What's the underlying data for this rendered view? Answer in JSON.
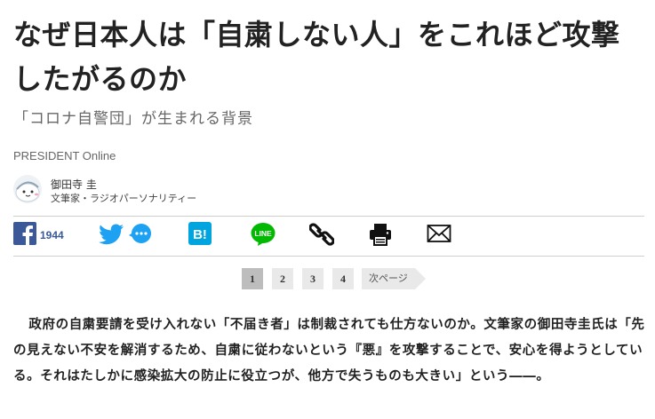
{
  "article": {
    "title": "なぜ日本人は「自粛しない人」をこれほど攻撃したがるのか",
    "subtitle": "「コロナ自警団」が生まれる背景",
    "publisher": "PRESIDENT Online",
    "author": {
      "name": "御田寺 圭",
      "role": "文筆家・ラジオパーソナリティー"
    },
    "body": "政府の自粛要請を受け入れない「不届き者」は制裁されても仕方ないのか。文筆家の御田寺圭氏は「先の見えない不安を解消するため、自粛に従わないという『悪』を攻撃することで、安心を得ようとしている。それはたしかに感染拡大の防止に役立つが、他方で失うものも大きい」という――。"
  },
  "share": {
    "facebook_count": "1944",
    "icons": [
      "facebook-icon",
      "twitter-icon",
      "comment-icon",
      "hatena-bookmark-icon",
      "line-icon",
      "link-icon",
      "print-icon",
      "mail-icon"
    ],
    "line_label": "LINE",
    "hatena_label": "B!"
  },
  "pagination": {
    "pages": [
      "1",
      "2",
      "3",
      "4"
    ],
    "current": "1",
    "next_label": "次ページ"
  },
  "colors": {
    "facebook": "#3b5998",
    "twitter": "#1da1f2",
    "hatena": "#00a4de",
    "line": "#00b900"
  }
}
